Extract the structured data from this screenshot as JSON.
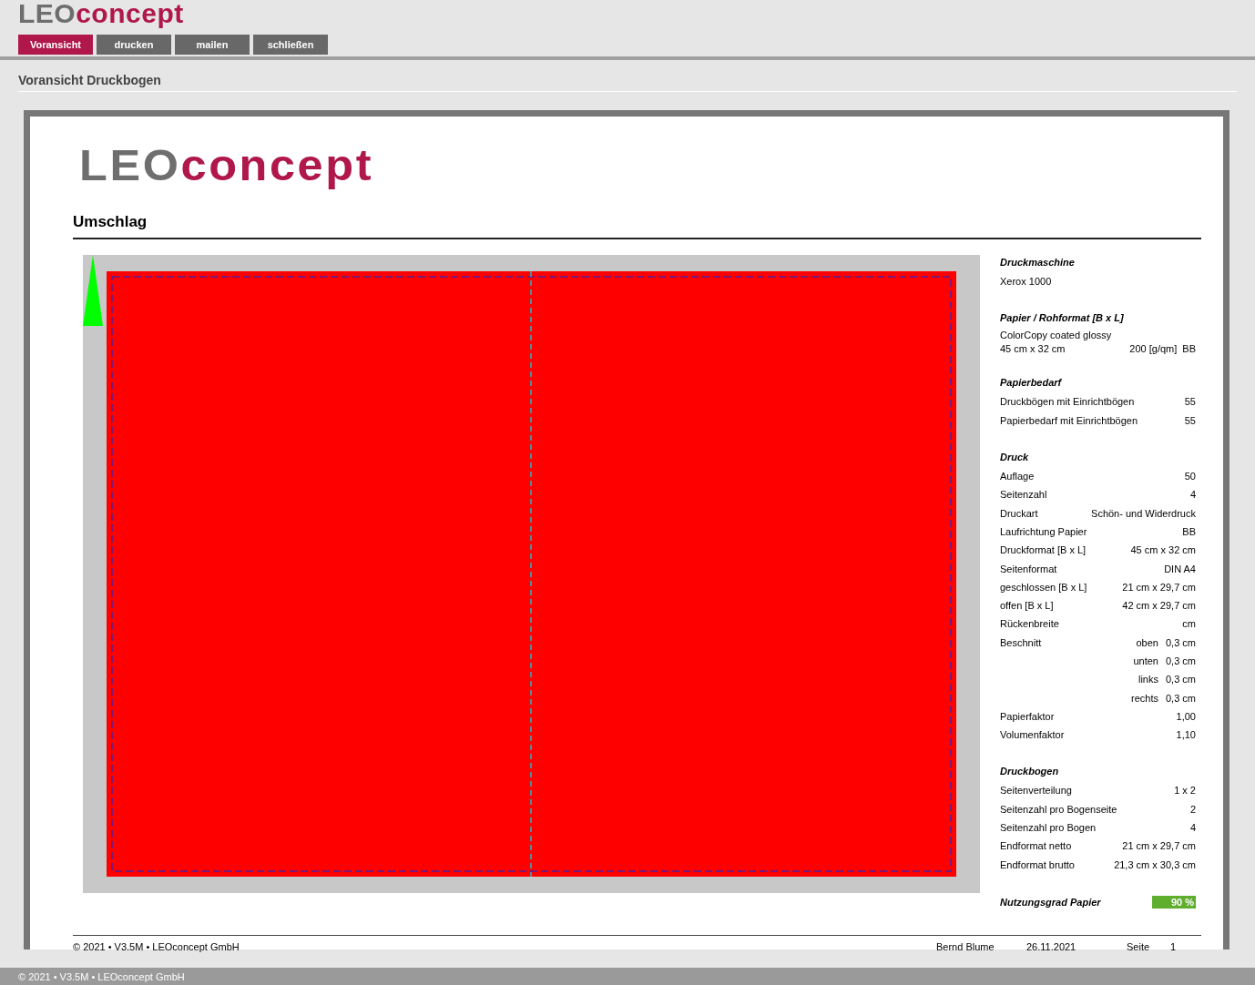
{
  "logo": {
    "part_1": "LEO",
    "part_2": "concept"
  },
  "tabs": [
    {
      "label": "Voransicht",
      "selected": true
    },
    {
      "label": "drucken",
      "selected": false
    },
    {
      "label": "mailen",
      "selected": false
    },
    {
      "label": "schließen",
      "selected": false
    }
  ],
  "page_title": "Voransicht Druckbogen",
  "sheet": {
    "logo": {
      "part_1": "LEO",
      "part_2": "concept"
    },
    "heading": "Umschlag",
    "sections": [
      {
        "title": "Druckmaschine",
        "rows": [
          {
            "label": "Xerox 1000"
          }
        ]
      },
      {
        "title": "Papier / Rohformat [B x L]",
        "rows": [
          {
            "label": "ColorCopy coated glossy"
          },
          {
            "label": "45 cm  x  32 cm",
            "middle": "200 [g/qm]",
            "value": "BB"
          }
        ]
      },
      {
        "title": "Papierbedarf",
        "rows": [
          {
            "label": "Druckbögen mit Einrichtbögen",
            "value": "55"
          },
          {
            "label": "Papierbedarf mit Einrichtbögen",
            "value": "55"
          }
        ]
      },
      {
        "title": "Druck",
        "rows": [
          {
            "label": "Auflage",
            "value": "50"
          },
          {
            "label": "Seitenzahl",
            "value": "4"
          },
          {
            "label": "Druckart",
            "value": "Schön- und Widerdruck"
          },
          {
            "label": "Laufrichtung Papier",
            "value": "BB"
          },
          {
            "label": "Druckformat [B x L]",
            "value": "45 cm x 32 cm"
          },
          {
            "label": "Seitenformat",
            "value": "DIN A4"
          },
          {
            "label": "geschlossen [B x L]",
            "value": "21 cm x 29,7 cm"
          },
          {
            "label": "offen [B x L]",
            "value": "42 cm x 29,7 cm"
          },
          {
            "label": "Rückenbreite",
            "value": "cm"
          },
          {
            "label": "Beschnitt",
            "middle": "oben",
            "value": "0,3 cm"
          },
          {
            "middle": "unten",
            "value": "0,3 cm"
          },
          {
            "middle": "links",
            "value": "0,3 cm"
          },
          {
            "middle": "rechts",
            "value": "0,3 cm"
          },
          {
            "label": "Papierfaktor",
            "value": "1,00"
          },
          {
            "label": "Volumenfaktor",
            "value": "1,10"
          }
        ]
      },
      {
        "title": "Druckbogen",
        "rows": [
          {
            "label": "Seitenverteilung",
            "value": "1 x 2"
          },
          {
            "label": "Seitenzahl pro Bogenseite",
            "value": "2"
          },
          {
            "label": "Seitenzahl pro Bogen",
            "value": "4"
          },
          {
            "label": "Endformat netto",
            "value": "21 cm x 29,7 cm"
          },
          {
            "label": "Endformat brutto",
            "value": "21,3 cm x 30,3 cm"
          }
        ]
      }
    ],
    "utilization": {
      "label": "Nutzungsgrad Papier",
      "value": "90 %"
    },
    "footer": {
      "copyright": "© 2021 • V3.5M • LEOconcept GmbH",
      "user": "Bernd Blume",
      "date": "26.11.2021",
      "page_label": "Seite",
      "page_number": "1"
    }
  },
  "status_bar": "© 2021 • V3.5M • LEOconcept GmbH"
}
